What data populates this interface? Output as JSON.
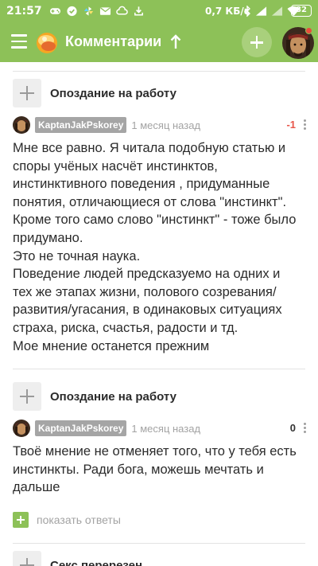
{
  "status_bar": {
    "time": "21:57",
    "left_icons": [
      "gamepad-icon",
      "check-badge-icon",
      "pinwheel-icon",
      "mail-icon",
      "cloud-icon",
      "download-icon"
    ],
    "net_speed": "0,7 КБ/с",
    "right_icons": [
      "bluetooth-icon",
      "signal-icon",
      "signal-icon",
      "wifi-icon"
    ],
    "battery": "82"
  },
  "app_bar": {
    "title": "Комментарии",
    "accent_color": "#8dc158"
  },
  "comments": [
    {
      "post_title": "Опоздание на работу",
      "author": "KaptanJakPskorey",
      "time": "1 месяц назад",
      "rating": "-1",
      "text_lines": [
        "Мне все равно. Я читала подобную статью и",
        "споры учёных насчёт инстинктов,",
        "инстинктивного поведения , придуманные",
        "понятия, отличающиеся от слова \"инстинкт\".",
        "Кроме того само слово \"инстинкт\" - тоже было",
        "придумано.",
        "Это не точная наука.",
        "Поведение людей предсказуемо на одних и",
        "тех же этапах жизни, полового созревания/",
        "развития/угасания, в одинаковых ситуациях",
        "страха, риска, счастья, радости и тд.",
        "Мое мнение останется прежним"
      ]
    },
    {
      "post_title": "Опоздание на работу",
      "author": "KaptanJakPskorey",
      "time": "1 месяц назад",
      "rating": "0",
      "text_lines": [
        "Твоё мнение не отменяет того, что у тебя есть",
        "инстинкты. Ради бога, можешь мечтать и",
        "дальше"
      ],
      "show_replies": "показать ответы"
    }
  ],
  "next_post_title": "Секс перерезен"
}
